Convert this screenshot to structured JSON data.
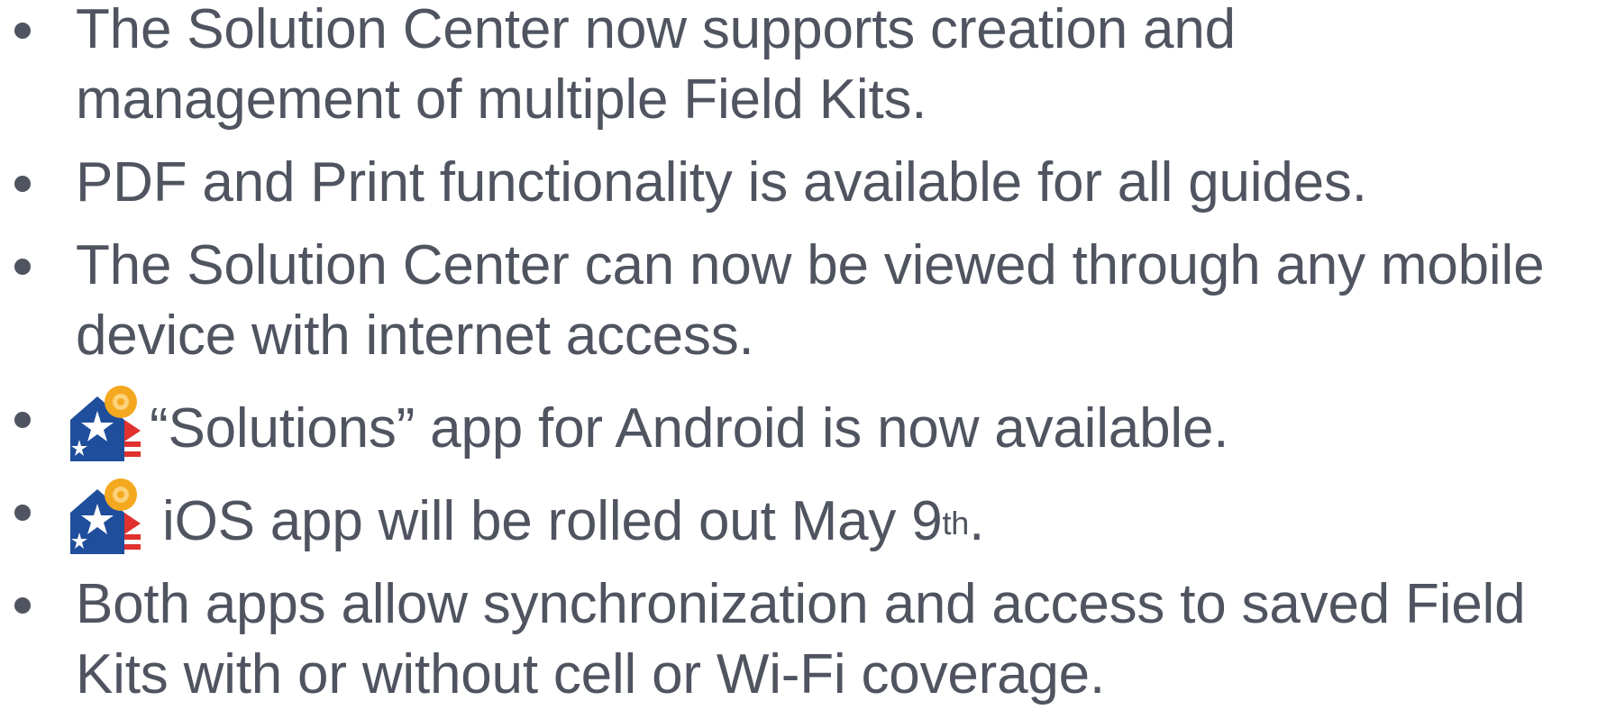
{
  "colors": {
    "text": "#4f5460",
    "icon_blue": "#1f4e9c",
    "icon_red": "#e0312f",
    "icon_gold": "#f4a81f"
  },
  "bullets": [
    {
      "lines": [
        "The Solution Center now supports creation and",
        "management of multiple Field Kits."
      ]
    },
    {
      "lines": [
        "PDF and Print functionality is available for all guides."
      ]
    },
    {
      "lines": [
        "The Solution Center can now be viewed through any mobile",
        "device with internet access."
      ]
    },
    {
      "icon": "solutions-app-icon",
      "text": "“Solutions” app for Android is now available."
    },
    {
      "icon": "solutions-app-icon",
      "text_before": "iOS app will be rolled out May 9",
      "superscript": "th",
      "text_after": "."
    },
    {
      "lines": [
        "Both apps allow synchronization and access to saved Field",
        "Kits with or without cell or Wi-Fi coverage."
      ]
    }
  ]
}
